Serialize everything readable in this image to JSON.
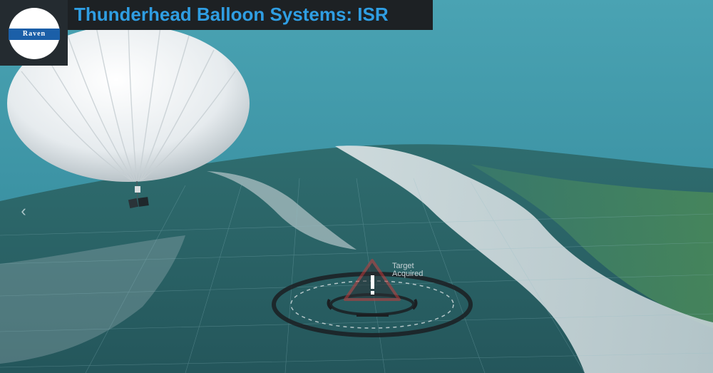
{
  "header": {
    "title": "Thunderhead Balloon Systems: ISR"
  },
  "logo": {
    "text": "Raven"
  },
  "overlay": {
    "target_line1": "Target",
    "target_line2": "Acquired"
  },
  "navigation": {
    "prev_symbol": "‹"
  },
  "colors": {
    "sky": "#3a8fa0",
    "title_text": "#2f9ee3",
    "title_bg": "#1d2124",
    "logo_band": "#1b5fa8",
    "alert_red": "#c43a3a"
  }
}
